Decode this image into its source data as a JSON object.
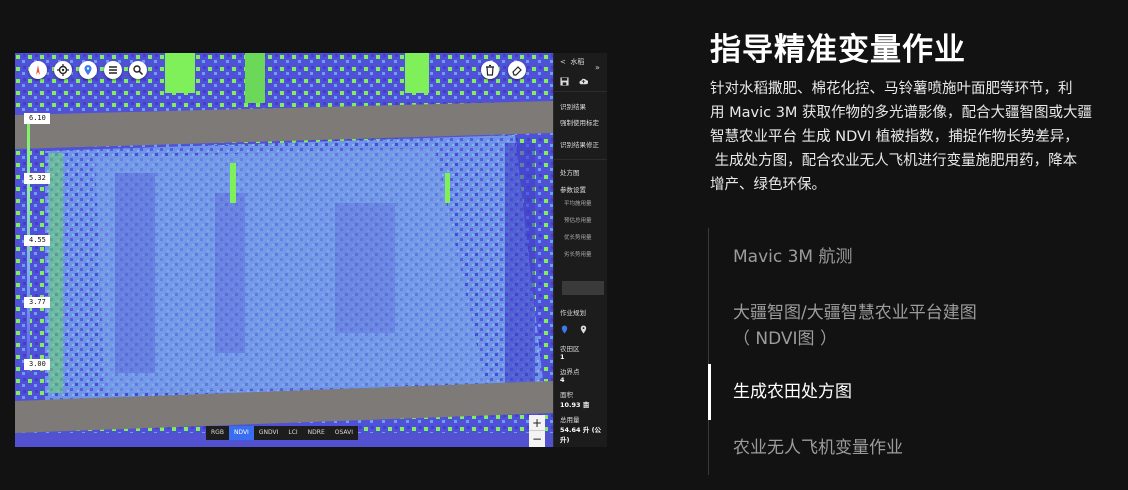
{
  "app": {
    "scale_ticks": [
      "6.10",
      "5.32",
      "4.55",
      "3.77",
      "3.00"
    ],
    "bands": [
      {
        "label": "RGB",
        "active": false
      },
      {
        "label": "NDVI",
        "active": true
      },
      {
        "label": "GNDVI",
        "active": false
      },
      {
        "label": "LCI",
        "active": false
      },
      {
        "label": "NDRE",
        "active": false
      },
      {
        "label": "OSAVI",
        "active": false
      }
    ],
    "zoom": {
      "in": "+",
      "out": "−"
    },
    "expand": "»",
    "sidebar": {
      "back": "<",
      "crop": "水稻",
      "recognition_results": "识别结果",
      "force_label": "强制使用标定",
      "result_correction": "识别结果修正",
      "prescription": "处方图",
      "params": "参数设置",
      "param_rows": [
        "平均施用量",
        "预估总用量",
        "优长势用量",
        "劣长势用量"
      ],
      "job_planning": "作业规划",
      "field_label": "农田区",
      "field_value": "1",
      "boundary_label": "边界点",
      "boundary_value": "4",
      "area_label": "面积",
      "area_value": "10.93 亩",
      "total_label": "总用量",
      "total_value": "54.64 升 (公升)"
    }
  },
  "panel": {
    "title": "指导精准变量作业",
    "description_lines": [
      "针对水稻撒肥、棉花化控、马铃薯喷施叶面肥等环节，利",
      "用 Mavic 3M 获取作物的多光谱影像，配合大疆智图或大疆",
      "智慧农业平台 生成 NDVI 植被指数，捕捉作物长势差异，",
      " 生成处方图，配合农业无人飞机进行变量施肥用药，降本",
      "增产、绿色环保。"
    ],
    "steps": [
      {
        "line1": "Mavic 3M 航测",
        "line2": "",
        "active": false
      },
      {
        "line1": "大疆智图/大疆智慧农业平台建图",
        "line2": "（ NDVI图 ）",
        "active": false
      },
      {
        "line1": "生成农田处方图",
        "line2": "",
        "active": true
      },
      {
        "line1": "农业无人飞机变量作业",
        "line2": "",
        "active": false
      }
    ]
  },
  "colors": {
    "page_bg": "#121212",
    "ndvi_low": "#5a5ae8",
    "ndvi_mid": "#7aa8f0",
    "ndvi_high": "#7ff05a",
    "road": "#7d7a78",
    "active_band": "#3a6ef0"
  }
}
